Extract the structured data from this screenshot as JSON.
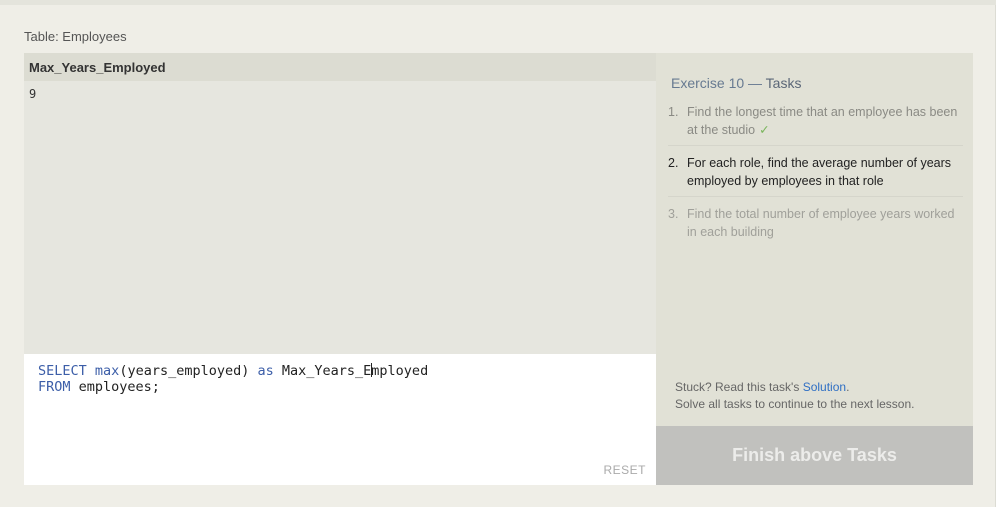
{
  "table_label": "Table: Employees",
  "results": {
    "columns": [
      "Max_Years_Employed"
    ],
    "rows": [
      [
        "9"
      ]
    ]
  },
  "editor": {
    "line1": {
      "kw1": "SELECT",
      "fn": "max",
      "text1": "(years_employed) ",
      "kw2": "as",
      "text2a": " Max_Years_E",
      "text2b": "mployed"
    },
    "line2": {
      "kw": "FROM",
      "text": " employees;"
    },
    "reset_label": "RESET"
  },
  "tasks": {
    "title_prefix": "Exercise 10 — ",
    "title_suffix": "Tasks",
    "items": [
      {
        "num": "1.",
        "text": "Find the longest time that an employee has been at the studio",
        "state": "done",
        "check": "✓"
      },
      {
        "num": "2.",
        "text": "For each role, find the average number of years employed by employees in that role",
        "state": "current"
      },
      {
        "num": "3.",
        "text": "Find the total number of employee years worked in each building",
        "state": "pending"
      }
    ],
    "help_prefix": "Stuck? Read this task's ",
    "help_link": "Solution",
    "help_suffix": ".",
    "help_line2": "Solve all tasks to continue to the next lesson."
  },
  "finish_button": "Finish above Tasks"
}
